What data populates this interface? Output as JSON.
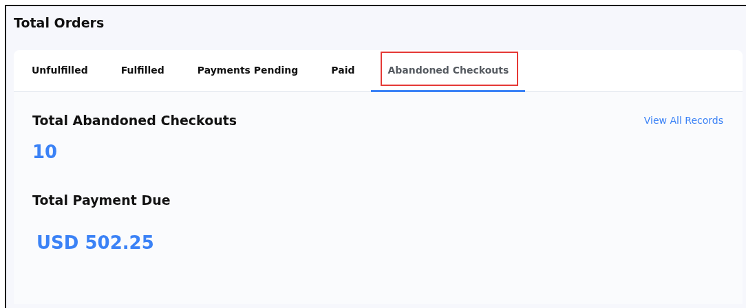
{
  "title": "Total Orders",
  "tabs": [
    {
      "label": "Unfulfilled",
      "selected": false,
      "highlighted": false
    },
    {
      "label": "Fulfilled",
      "selected": false,
      "highlighted": false
    },
    {
      "label": "Payments Pending",
      "selected": false,
      "highlighted": false
    },
    {
      "label": "Paid",
      "selected": false,
      "highlighted": false
    },
    {
      "label": "Abandoned Checkouts",
      "selected": true,
      "highlighted": true
    }
  ],
  "summary": {
    "heading": "Total Abandoned Checkouts",
    "link": "View All Records",
    "count": "10",
    "payment_heading": "Total Payment Due",
    "payment_amount": "USD 502.25"
  }
}
